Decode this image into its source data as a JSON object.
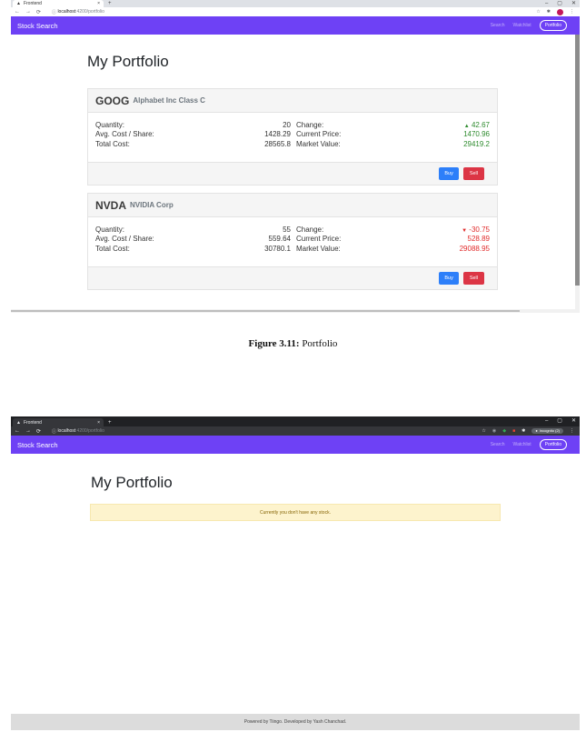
{
  "screenshot1": {
    "tab": {
      "title": "Frontend",
      "close": "×",
      "new": "+"
    },
    "window_controls": [
      "–",
      "▢",
      "✕"
    ],
    "address": {
      "host": "localhost",
      "path": ":4200/portfolio"
    },
    "navbar": {
      "brand": "Stock Search",
      "links": {
        "search": "Search",
        "watchlist": "Watchlist",
        "portfolio": "Portfolio"
      }
    },
    "page_title": "My Portfolio",
    "holdings": [
      {
        "ticker": "GOOG",
        "name": "Alphabet Inc Class C",
        "quantity": "20",
        "avg_cost": "1428.29",
        "total_cost": "28565.8",
        "change": "42.67",
        "change_arrow": "▲",
        "current_price": "1470.96",
        "market_value": "29419.2",
        "trend_color": "#2e8b2e"
      },
      {
        "ticker": "NVDA",
        "name": "NVIDIA Corp",
        "quantity": "55",
        "avg_cost": "559.64",
        "total_cost": "30780.1",
        "change": "-30.75",
        "change_arrow": "▼",
        "current_price": "528.89",
        "market_value": "29088.95",
        "trend_color": "#e12b2b"
      }
    ],
    "labels": {
      "quantity": "Quantity:",
      "avg_cost": "Avg. Cost / Share:",
      "total_cost": "Total Cost:",
      "change": "Change:",
      "current_price": "Current Price:",
      "market_value": "Market Value:",
      "buy": "Buy",
      "sell": "Sell"
    }
  },
  "caption": {
    "label": "Figure 3.11:",
    "text": " Portfolio"
  },
  "screenshot2": {
    "tab": {
      "title": "Frontend",
      "close": "×",
      "new": "+"
    },
    "window_controls": [
      "–",
      "▢",
      "✕"
    ],
    "address": {
      "host": "localhost",
      "path": ":4200/portfolio"
    },
    "incognito": "Incognito (2)",
    "navbar": {
      "brand": "Stock Search",
      "links": {
        "search": "Search",
        "watchlist": "Watchlist",
        "portfolio": "Portfolio"
      }
    },
    "page_title": "My Portfolio",
    "empty_message": "Currently you don't have any stock.",
    "footer": "Powered by Tiingo. Developed by Yash Chanchad."
  },
  "colors": {
    "navbar": "#6e41f5",
    "buy": "#2d7ff9",
    "sell": "#dc3545",
    "alert_bg": "#fdf3cd"
  }
}
